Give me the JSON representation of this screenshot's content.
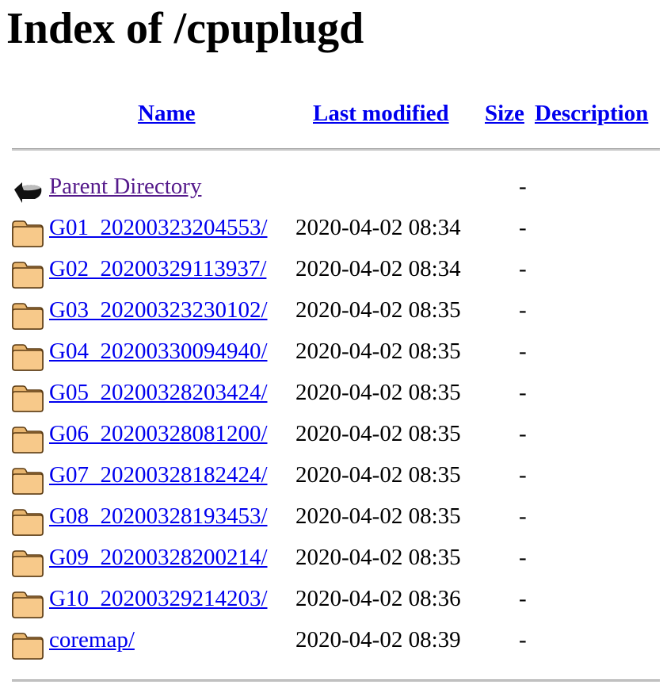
{
  "title": "Index of /cpuplugd",
  "columns": {
    "name": "Name",
    "last_modified": "Last modified",
    "size": "Size",
    "description": "Description"
  },
  "parent": {
    "name": "Parent Directory",
    "size": "-",
    "icon": "back-arrow-icon"
  },
  "entries": [
    {
      "name": "G01_20200323204553/",
      "date": "2020-04-02 08:34",
      "size": "-",
      "icon": "folder-icon"
    },
    {
      "name": "G02_20200329113937/",
      "date": "2020-04-02 08:34",
      "size": "-",
      "icon": "folder-icon"
    },
    {
      "name": "G03_20200323230102/",
      "date": "2020-04-02 08:35",
      "size": "-",
      "icon": "folder-icon"
    },
    {
      "name": "G04_20200330094940/",
      "date": "2020-04-02 08:35",
      "size": "-",
      "icon": "folder-icon"
    },
    {
      "name": "G05_20200328203424/",
      "date": "2020-04-02 08:35",
      "size": "-",
      "icon": "folder-icon"
    },
    {
      "name": "G06_20200328081200/",
      "date": "2020-04-02 08:35",
      "size": "-",
      "icon": "folder-icon"
    },
    {
      "name": "G07_20200328182424/",
      "date": "2020-04-02 08:35",
      "size": "-",
      "icon": "folder-icon"
    },
    {
      "name": "G08_20200328193453/",
      "date": "2020-04-02 08:35",
      "size": "-",
      "icon": "folder-icon"
    },
    {
      "name": "G09_20200328200214/",
      "date": "2020-04-02 08:35",
      "size": "-",
      "icon": "folder-icon"
    },
    {
      "name": "G10_20200329214203/",
      "date": "2020-04-02 08:36",
      "size": "-",
      "icon": "folder-icon"
    },
    {
      "name": "coremap/",
      "date": "2020-04-02 08:39",
      "size": "-",
      "icon": "folder-icon"
    }
  ],
  "colors": {
    "link": "#0000ee",
    "visited": "#551a8b",
    "folder": "#f7c98a"
  }
}
